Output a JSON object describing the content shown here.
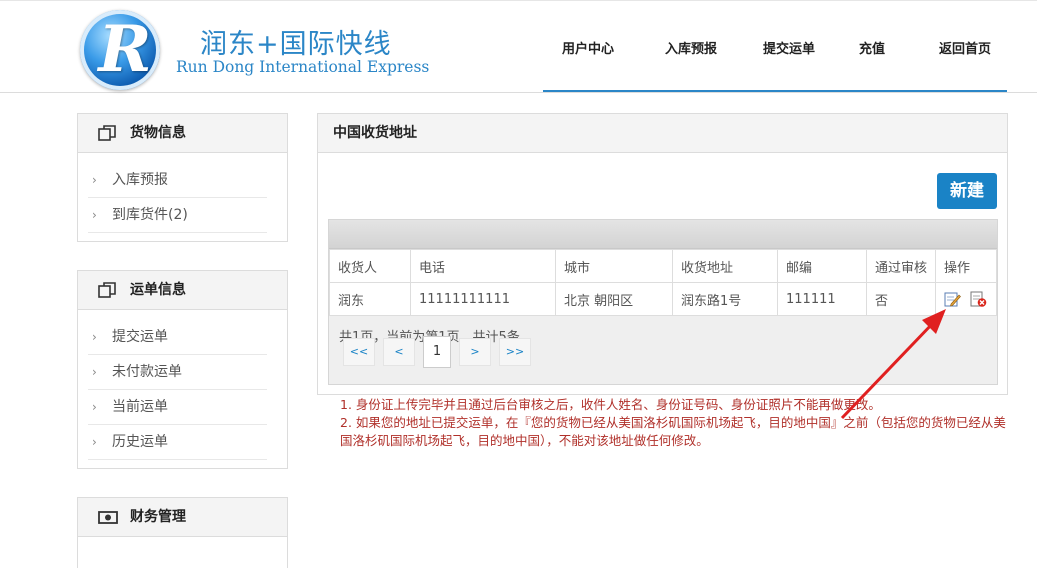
{
  "brand": {
    "logo_letter": "R",
    "name_cn": "润东+国际快线",
    "name_en": "Run Dong International Express"
  },
  "nav": {
    "items": [
      "用户中心",
      "入库预报",
      "提交运单",
      "充值",
      "返回首页"
    ]
  },
  "sidebar": {
    "goods": {
      "title": "货物信息",
      "items": [
        "入库预报",
        "到库货件(2)"
      ]
    },
    "waybill": {
      "title": "运单信息",
      "items": [
        "提交运单",
        "未付款运单",
        "当前运单",
        "历史运单"
      ]
    },
    "finance": {
      "title": "财务管理"
    }
  },
  "main": {
    "title": "中国收货地址",
    "new_button": "新建",
    "table": {
      "headers": [
        "收货人",
        "电话",
        "城市",
        "收货地址",
        "邮编",
        "通过审核",
        "操作"
      ],
      "rows": [
        [
          "润东",
          "11111111111",
          "北京 朝阳区",
          "润东路1号",
          "111111",
          "否",
          ""
        ]
      ]
    },
    "pager": {
      "info": "共1页，当前为第1页，共计5条",
      "first": "<<",
      "prev": "<",
      "current": "1",
      "next": ">",
      "last": ">>"
    }
  },
  "notes": [
    "1.  身份证上传完毕并且通过后台审核之后，收件人姓名、身份证号码、身份证照片不能再做更改。",
    "2.  如果您的地址已提交运单，在『您的货物已经从美国洛杉矶国际机场起飞，目的地中国』之前（包括您的货物已经从美国洛杉矶国际机场起飞，目的地中国），不能对该地址做任何修改。"
  ],
  "colors": {
    "accent": "#1a83c6",
    "brand_text": "#2b86c7",
    "note_text": "#b0302a",
    "arrow": "#e02020"
  },
  "icons": {
    "edit": "edit-icon",
    "delete": "delete-icon",
    "section": "copy-icon",
    "money": "money-icon"
  }
}
